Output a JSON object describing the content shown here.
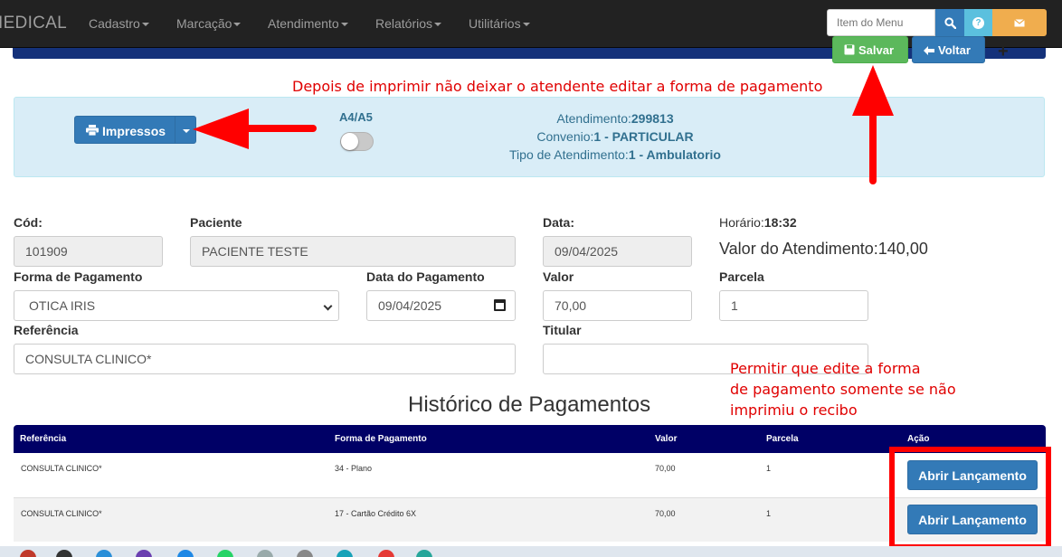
{
  "navbar": {
    "brand": "IEDICAL",
    "menu": [
      {
        "label": "Cadastro"
      },
      {
        "label": "Marcação"
      },
      {
        "label": "Atendimento"
      },
      {
        "label": "Relatórios"
      },
      {
        "label": "Utilitários"
      }
    ],
    "search_placeholder": "Item do Menu",
    "help_glyph": "?",
    "search_icon": "search-icon",
    "mail_icon": "envelope-icon"
  },
  "toolbar": {
    "save_label": "Salvar",
    "back_label": "Voltar",
    "plus_glyph": "+"
  },
  "annotations": {
    "top_note": "Depois de imprimir não deixar o atendente editar a forma de pagamento",
    "side_note": [
      "Permitir que edite a forma",
      "de pagamento somente se não",
      "imprimiu o recibo"
    ]
  },
  "info": {
    "impressos_label": "Impressos",
    "paper_label": "A4/A5",
    "toggle_on": false,
    "atendimento_label": "Atendimento:",
    "atendimento_value": "299813",
    "convenio_label": "Convenio:",
    "convenio_value": "1 - PARTICULAR",
    "tipo_label": "Tipo de Atendimento:",
    "tipo_value": "1 - Ambulatorio"
  },
  "form": {
    "cod_label": "Cód:",
    "cod_value": "101909",
    "paciente_label": "Paciente",
    "paciente_value": "PACIENTE TESTE",
    "data_label": "Data:",
    "data_value": "09/04/2025",
    "horario_label": "Horário:",
    "horario_value": "18:32",
    "valor_atend_label": "Valor do Atendimento:",
    "valor_atend_value": "140,00",
    "forma_label": "Forma de Pagamento",
    "forma_value": "OTICA IRIS",
    "data_pag_label": "Data do Pagamento",
    "data_pag_value": "09/04/2025",
    "valor_label": "Valor",
    "valor_value": "70,00",
    "parcela_label": "Parcela",
    "parcela_value": "1",
    "referencia_label": "Referência",
    "referencia_value": "CONSULTA CLINICO*",
    "titular_label": "Titular",
    "titular_value": ""
  },
  "history": {
    "title": "Histórico de Pagamentos",
    "columns": [
      "Referência",
      "Forma de Pagamento",
      "Valor",
      "Parcela",
      "Ação"
    ],
    "rows": [
      {
        "referencia": "CONSULTA CLINICO*",
        "forma": "34 - Plano",
        "valor": "70,00",
        "parcela": "1",
        "acao": "Abrir Lançamento"
      },
      {
        "referencia": "CONSULTA CLINICO*",
        "forma": "17 - Cartão Crédito 6X",
        "valor": "70,00",
        "parcela": "1",
        "acao": "Abrir Lançamento"
      }
    ]
  },
  "colors": {
    "navbar": "#222222",
    "primary": "#337ab7",
    "success": "#5cb85c",
    "info_panel": "#d9edf7",
    "table_header": "#000066",
    "annotation": "#e00000"
  }
}
